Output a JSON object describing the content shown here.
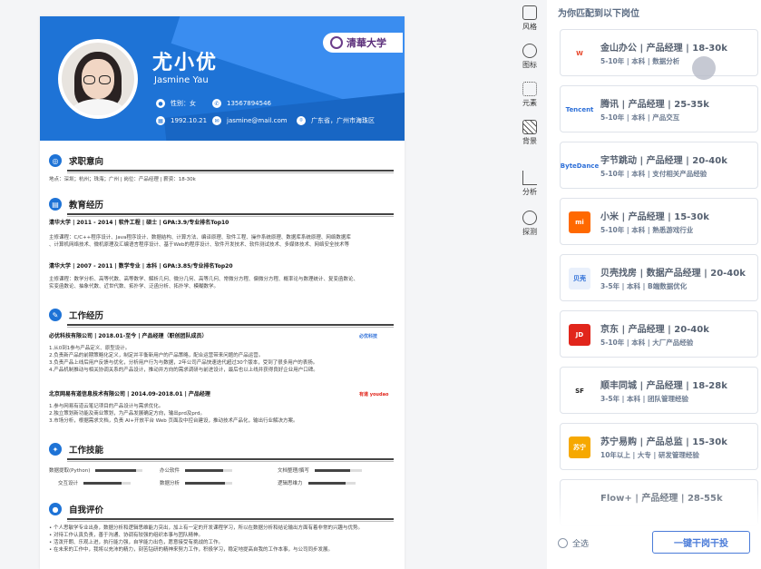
{
  "resume": {
    "name": "尤小优",
    "ename": "Jasmine Yau",
    "university_logo": "清華大学",
    "info": {
      "gender": "性别：女",
      "phone": "13567894546",
      "birth": "1992.10.21",
      "email": "jasmine@mail.com",
      "address": "广东省，广州市海珠区"
    },
    "sections": {
      "intent": "求职意向",
      "edu": "教育经历",
      "work": "工作经历",
      "skills": "工作技能",
      "self": "自我评价"
    },
    "intent_line": "地点：深圳；杭州；珠海；广州 | 岗位：产品经理 | 薪资：18-30k",
    "edu": [
      {
        "head": "清华大学 | 2011 - 2014 | 软件工程 | 硕士 | GPA:3.9/专业排名Top10",
        "l1": "主修课程：C/C++程序设计、Java程序设计、数据结构、计算方法、编译原理、软件工程、操作系统原理、数据库系统原理、网络数据库",
        "l2": "、计算机网络技术、微机原理及汇编语言程序设计、基于Web的程序设计、软件开发技术、软件测试技术、多媒体技术、网络安全技术等"
      },
      {
        "head": "清华大学 | 2007 - 2011 | 数学专业 | 本科 | GPA:3.85/专业排名Top20",
        "l1": "主修课程：数学分析、高等代数、高等数学、解析几何、微分几何、高等几何、常微分方程、偏微分方程、概率论与数理统计、复变函数论、",
        "l2": "实变函数论、抽象代数、近世代数、拓扑学、泛函分析、拓扑学、模糊数学。"
      }
    ],
    "work": [
      {
        "head": "必优科技有限公司 | 2018.01-至今 | 产品经理（职创团队成员）",
        "logo": "必优科技",
        "l1": "1.从0到1参与产品定义、原型设计。",
        "l2": "2.负责新产品的前期策略化定义，制定并平衡新用户的产品策略，配合运营带来问题的产品运营。",
        "l3": "3.负责产品上线后用户反馈与优化，分析用户行为与数据，2年公司产品快速迭代超过30个版本，受到了很多用户的表扬。",
        "l4": "4.产品机制推动与相关协调关系的产品设计，推动并方向的需求调研与前进设计，最后也以上线并获得良好企业用户口碑。"
      },
      {
        "head": "北京网易有道信息技术有限公司 | 2014.09-2018.01 | 产品经理",
        "logo": "有道 youdao",
        "l1": "1.参与网易有道云笔记项目的产品设计与需求优化。",
        "l2": "2.独立策划新功能及商业策划，为产品发展确定方向，输出prd及prd。",
        "l3": "3.市场分析，根据需求文档，负责 AI+开放平台 Web 页面及中控台建设，推动技术产品化，输出行业解决方案。"
      }
    ],
    "skills": [
      {
        "label": "数据提取(Python)",
        "level": 0.85
      },
      {
        "label": "办公软件",
        "level": 0.8
      },
      {
        "label": "文档整理/撰写",
        "level": 0.75
      },
      {
        "label": "交互设计",
        "level": 0.8
      },
      {
        "label": "数据分析",
        "level": 0.85
      },
      {
        "label": "逻辑思维力",
        "level": 0.8
      }
    ],
    "self": [
      "• 个人思敏学专业出身，数据分析和逻辑思维能力突出，加上有一定的开发课程学习，所以在数据分析和结论输出方面有着非常的兴趣与优势。",
      "• 对待工作认真负责，善于沟通、协调有较强的组织本事与团队精神。",
      "• 活泼开朗、乐观上进，执行能力强，自学能力出色，愿意接受有挑战的工作。",
      "• 在未来的工作中，我将以充沛的精力，刻苦钻研的精神来努力工作，积极学习，稳定地提高自我的工作本事，与公司同步发展。"
    ]
  },
  "sidebar": [
    "风格",
    "图标",
    "元素",
    "背景",
    "分析",
    "探测"
  ],
  "panel": {
    "title": "为你匹配到以下岗位",
    "jobs": [
      {
        "title": "金山办公 | 产品经理 | 18-30k",
        "sub": "5-10年 | 本科 | 数据分析",
        "logo": "W",
        "color": "#e8472b",
        "bg": "#fff"
      },
      {
        "title": "腾讯 | 产品经理 | 25-35k",
        "sub": "5-10年 | 本科 | 产品交互",
        "logo": "Tencent",
        "color": "#2d6fd8",
        "bg": "#fff"
      },
      {
        "title": "字节跳动 | 产品经理 | 20-40k",
        "sub": "5-10年 | 本科 | 支付相关产品经验",
        "logo": "ByteDance",
        "color": "#2d6fd8",
        "bg": "#fff"
      },
      {
        "title": "小米 | 产品经理 | 15-30k",
        "sub": "5-10年 | 本科 | 熟悉游戏行业",
        "logo": "mi",
        "color": "#fff",
        "bg": "#ff6900"
      },
      {
        "title": "贝壳找房 | 数据产品经理 | 20-40k",
        "sub": "3-5年 | 本科 | B端数据优化",
        "logo": "贝壳",
        "color": "#2d6fd8",
        "bg": "#e9f0fb"
      },
      {
        "title": "京东 | 产品经理 | 20-40k",
        "sub": "5-10年 | 本科 | 大厂产品经验",
        "logo": "JD",
        "color": "#fff",
        "bg": "#e1251b"
      },
      {
        "title": "顺丰同城 | 产品经理 | 18-28k",
        "sub": "3-5年 | 本科 | 团队管理经验",
        "logo": "SF",
        "color": "#222",
        "bg": "#fff"
      },
      {
        "title": "苏宁易购 | 产品总监 | 15-30k",
        "sub": "10年以上 | 大专 | 研发管理经验",
        "logo": "苏宁",
        "color": "#fff",
        "bg": "#f6a800"
      },
      {
        "title": "Flow+ | 产品经理 | 28-55k",
        "sub": "",
        "logo": "",
        "color": "#222",
        "bg": "#fff"
      }
    ],
    "select_all": "全选",
    "apply_button": "一键干岗干投"
  }
}
